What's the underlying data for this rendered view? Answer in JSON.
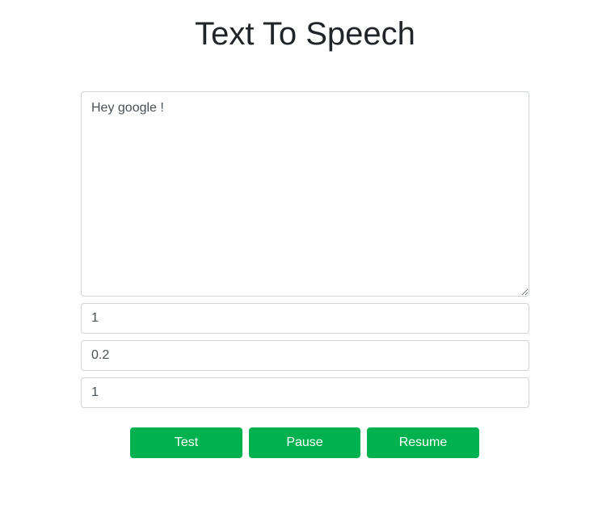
{
  "page": {
    "title": "Text To Speech"
  },
  "form": {
    "text_value": "Hey google !",
    "rate_value": "1",
    "pitch_value": "0.2",
    "volume_value": "1"
  },
  "buttons": {
    "test_label": "Test",
    "pause_label": "Pause",
    "resume_label": "Resume"
  },
  "colors": {
    "button_bg": "#00b14f",
    "button_text": "#ffffff",
    "input_border": "#ced4da",
    "title_text": "#212529"
  }
}
